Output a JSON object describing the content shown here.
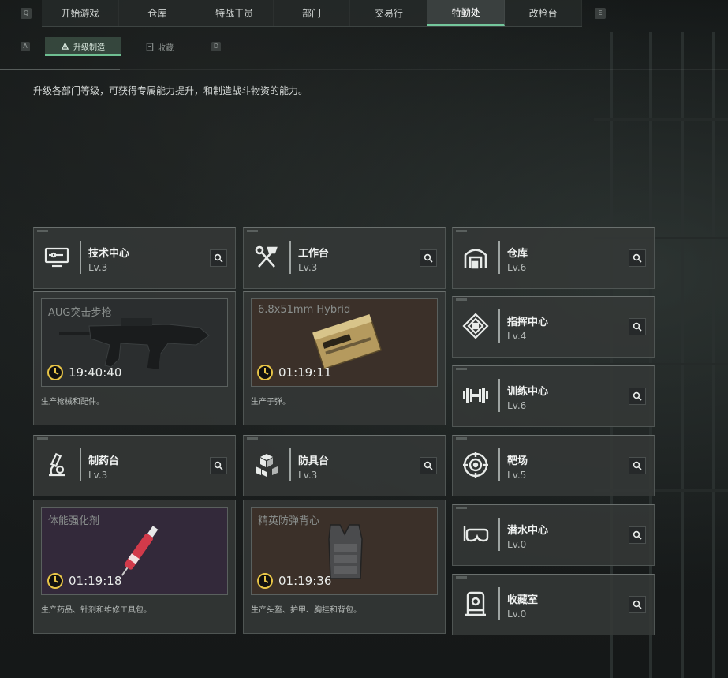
{
  "top_nav": {
    "left_key": "Q",
    "right_key": "E",
    "tabs": [
      {
        "label": "开始游戏"
      },
      {
        "label": "仓库"
      },
      {
        "label": "特战干员"
      },
      {
        "label": "部门"
      },
      {
        "label": "交易行"
      },
      {
        "label": "特勤处",
        "active": true
      },
      {
        "label": "改枪台"
      }
    ]
  },
  "sub_nav": {
    "left_key": "A",
    "right_key": "D",
    "tabs": [
      {
        "label": "升级制造",
        "active": true
      },
      {
        "label": "收藏"
      }
    ]
  },
  "description": "升级各部门等级，可获得专属能力提升，和制造战斗物资的能力。",
  "departments": {
    "tech": {
      "name": "技术中心",
      "level": "Lv.3"
    },
    "workbench": {
      "name": "工作台",
      "level": "Lv.3"
    },
    "pharmacy": {
      "name": "制药台",
      "level": "Lv.3"
    },
    "armor": {
      "name": "防具台",
      "level": "Lv.3"
    },
    "warehouse": {
      "name": "仓库",
      "level": "Lv.6"
    },
    "command": {
      "name": "指挥中心",
      "level": "Lv.4"
    },
    "training": {
      "name": "训练中心",
      "level": "Lv.6"
    },
    "range": {
      "name": "靶场",
      "level": "Lv.5"
    },
    "diving": {
      "name": "潜水中心",
      "level": "Lv.0"
    },
    "collection": {
      "name": "收藏室",
      "level": "Lv.0"
    }
  },
  "production": {
    "tech": {
      "item": "AUG突击步枪",
      "timer": "19:40:40",
      "desc": "生产枪械和配件。",
      "color": "#2b2e2f"
    },
    "workbench": {
      "item": "6.8x51mm Hybrid",
      "timer": "01:19:11",
      "desc": "生产子弹。",
      "color": "#3b3029"
    },
    "pharmacy": {
      "item": "体能强化剂",
      "timer": "01:19:18",
      "desc": "生产药品、针剂和维修工具包。",
      "color": "#33293a"
    },
    "armor": {
      "item": "精英防弹背心",
      "timer": "01:19:36",
      "desc": "生产头盔、护甲、胸挂和背包。",
      "color": "#3b3029"
    }
  },
  "colors": {
    "accent": "#6fbf92",
    "timer_icon": "#e8c547"
  }
}
